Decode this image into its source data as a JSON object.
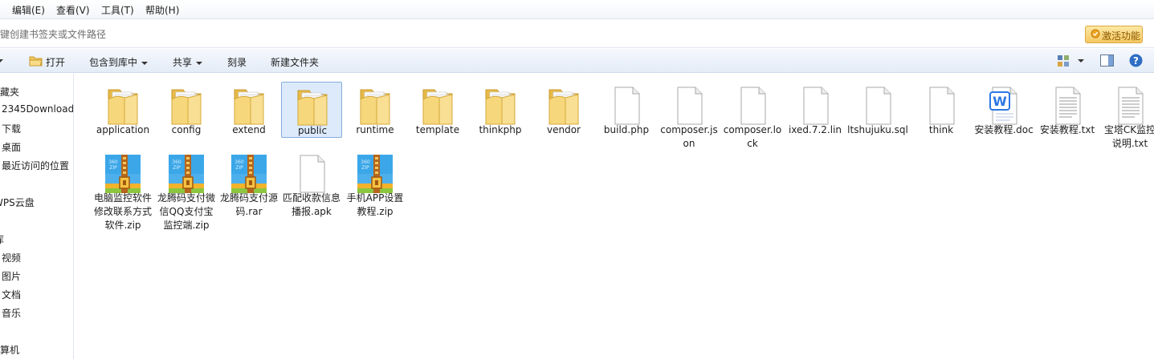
{
  "menubar": {
    "items": [
      {
        "label": "编辑(E)"
      },
      {
        "label": "查看(V)"
      },
      {
        "label": "工具(T)"
      },
      {
        "label": "帮助(H)"
      }
    ]
  },
  "address": {
    "hint": "键创建书签夹或文件路径",
    "activate_label": "激活功能"
  },
  "toolbar": {
    "open": "打开",
    "include_library": "包含到库中",
    "share": "共享",
    "burn": "刻录",
    "new_folder": "新建文件夹"
  },
  "sidebar": {
    "items": [
      {
        "label": "收藏夹"
      },
      {
        "label": "2345Download"
      },
      {
        "label": "下载"
      },
      {
        "label": "桌面"
      },
      {
        "label": "最近访问的位置"
      },
      {
        "label": "WPS云盘"
      },
      {
        "label": "库"
      },
      {
        "label": "视频"
      },
      {
        "label": "图片"
      },
      {
        "label": "文档"
      },
      {
        "label": "音乐"
      },
      {
        "label": "计算机"
      }
    ]
  },
  "files": [
    {
      "name": "application",
      "type": "folder"
    },
    {
      "name": "config",
      "type": "folder"
    },
    {
      "name": "extend",
      "type": "folder"
    },
    {
      "name": "public",
      "type": "folder"
    },
    {
      "name": "runtime",
      "type": "folder"
    },
    {
      "name": "template",
      "type": "folder"
    },
    {
      "name": "thinkphp",
      "type": "folder"
    },
    {
      "name": "vendor",
      "type": "folder"
    },
    {
      "name": "build.php",
      "type": "blank"
    },
    {
      "name": "composer.json",
      "type": "blank"
    },
    {
      "name": "composer.lock",
      "type": "blank"
    },
    {
      "name": "ixed.7.2.lin",
      "type": "blank"
    },
    {
      "name": "ltshujuku.sql",
      "type": "blank"
    },
    {
      "name": "think",
      "type": "blank"
    },
    {
      "name": "安装教程.doc",
      "type": "doc"
    },
    {
      "name": "安装教程.txt",
      "type": "txt"
    },
    {
      "name": "宝塔CK监控说明.txt",
      "type": "txt"
    },
    {
      "name": "电脑监控软件修改联系方式软件.zip",
      "type": "zip"
    },
    {
      "name": "龙腾码支付微信QQ支付宝监控端.zip",
      "type": "zip"
    },
    {
      "name": "龙腾码支付源码.rar",
      "type": "zip"
    },
    {
      "name": "匹配收款信息播报.apk",
      "type": "blank"
    },
    {
      "name": "手机APP设置教程.zip",
      "type": "zip"
    }
  ],
  "zip_badge": {
    "top": "360",
    "bottom": "ZIP"
  },
  "doc_badge": "W",
  "colors": {
    "selection": "#dceafc",
    "selection_border": "#84acdd",
    "folder": "#f5d57c",
    "zip_blue": "#3ba7e8"
  }
}
